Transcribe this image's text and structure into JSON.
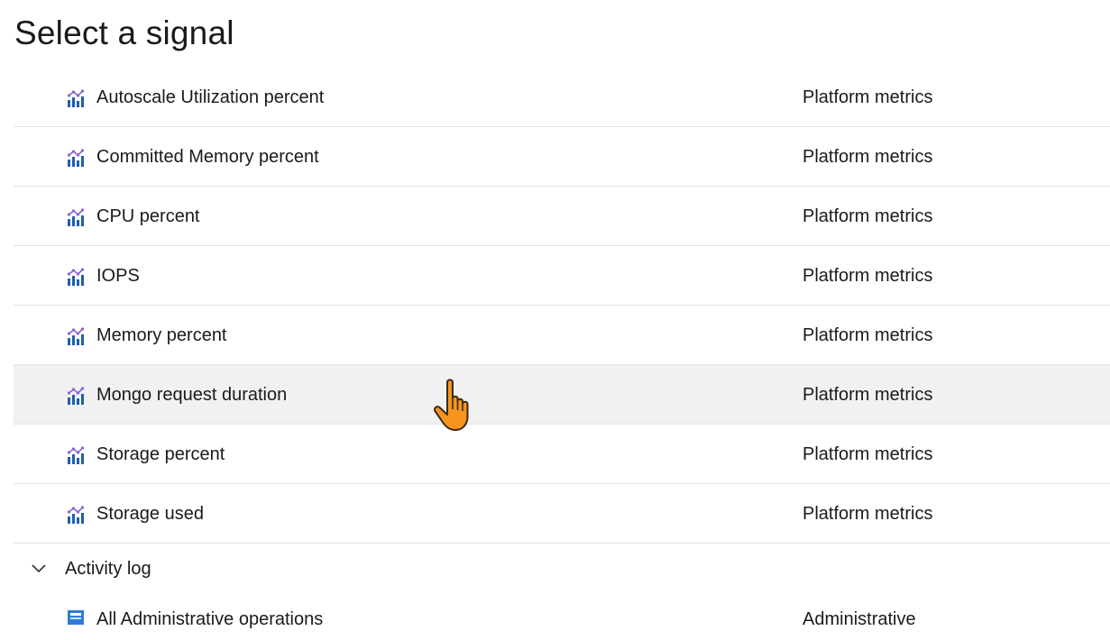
{
  "page": {
    "title": "Select a signal"
  },
  "signals": [
    {
      "name": "Autoscale Utilization percent",
      "type": "Platform metrics",
      "icon": "metric-chart-icon"
    },
    {
      "name": "Committed Memory percent",
      "type": "Platform metrics",
      "icon": "metric-chart-icon"
    },
    {
      "name": "CPU percent",
      "type": "Platform metrics",
      "icon": "metric-chart-icon"
    },
    {
      "name": "IOPS",
      "type": "Platform metrics",
      "icon": "metric-chart-icon"
    },
    {
      "name": "Memory percent",
      "type": "Platform metrics",
      "icon": "metric-chart-icon"
    },
    {
      "name": "Mongo request duration",
      "type": "Platform metrics",
      "icon": "metric-chart-icon",
      "hovered": true
    },
    {
      "name": "Storage percent",
      "type": "Platform metrics",
      "icon": "metric-chart-icon"
    },
    {
      "name": "Storage used",
      "type": "Platform metrics",
      "icon": "metric-chart-icon"
    }
  ],
  "activity_log": {
    "label": "Activity log",
    "expanded": true,
    "icon": "chevron-down-icon",
    "items": [
      {
        "name": "All Administrative operations",
        "type": "Administrative",
        "icon": "log-icon"
      }
    ]
  },
  "cursor": {
    "icon": "hand-pointer-cursor-icon",
    "color": "#f7941d"
  },
  "colors": {
    "hover_background": "#f1f1f1",
    "divider": "#e3e3e3",
    "text": "#1b1a19",
    "icon_blue": "#1f5fae",
    "icon_purple": "#8a63d2",
    "log_icon_blue": "#2f7bd6"
  }
}
